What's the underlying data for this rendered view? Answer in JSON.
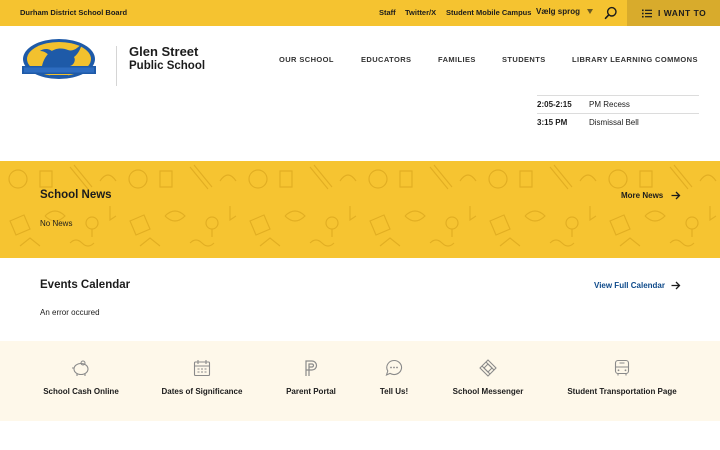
{
  "topbar": {
    "board_name": "Durham District School Board",
    "links": [
      "Staff",
      "Twitter/X",
      "Student Mobile Campus"
    ],
    "language_label": "Vælg sprog",
    "i_want_to": "I WANT TO",
    "colors": {
      "bar": "#f5c330",
      "iwant_bg": "#d8ab2c"
    }
  },
  "header": {
    "school_line1": "Glen Street",
    "school_line2": "Public School",
    "nav": [
      "OUR SCHOOL",
      "EDUCATORS",
      "FAMILIES",
      "STUDENTS",
      "LIBRARY LEARNING COMMONS"
    ]
  },
  "schedule": [
    {
      "time": "2:05-2:15",
      "event": "PM Recess"
    },
    {
      "time": "3:15 PM",
      "event": "Dismissal Bell"
    }
  ],
  "news": {
    "title": "School News",
    "more_label": "More News",
    "empty_text": "No News",
    "colors": {
      "background": "#f6c431"
    }
  },
  "events": {
    "title": "Events Calendar",
    "link_label": "View Full Calendar",
    "message": "An error occured",
    "colors": {
      "link": "#0e4a8a"
    }
  },
  "quick_links": [
    {
      "label": "School Cash Online",
      "icon": "piggy-bank-icon"
    },
    {
      "label": "Dates of Significance",
      "icon": "calendar-icon"
    },
    {
      "label": "Parent Portal",
      "icon": "parent-portal-icon"
    },
    {
      "label": "Tell Us!",
      "icon": "chat-bubble-icon"
    },
    {
      "label": "School Messenger",
      "icon": "messenger-icon"
    },
    {
      "label": "Student Transportation Page",
      "icon": "bus-icon"
    }
  ]
}
